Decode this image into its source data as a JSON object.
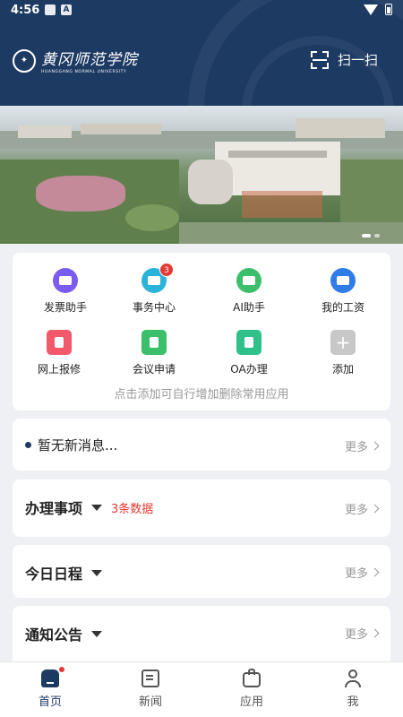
{
  "status_bar": {
    "time": "4:56",
    "icons": [
      "image-icon",
      "a-icon"
    ],
    "right_icons": [
      "wifi-icon",
      "battery-icon"
    ]
  },
  "header": {
    "logo_name": "黄冈师范学院",
    "logo_sub": "HUANGGANG NORMAL UNIVERSITY",
    "scan_label": "扫一扫"
  },
  "banner": {
    "page_count": 2,
    "active_page": 1
  },
  "apps": {
    "items": [
      {
        "label": "发票助手",
        "icon": "invoice-icon",
        "color": "#7b5cf0"
      },
      {
        "label": "事务中心",
        "icon": "affairs-icon",
        "color": "#2bb3d9",
        "badge": "3"
      },
      {
        "label": "AI助手",
        "icon": "ai-assistant-icon",
        "color": "#3cbf6a"
      },
      {
        "label": "我的工资",
        "icon": "salary-icon",
        "color": "#2f7de8"
      },
      {
        "label": "网上报修",
        "icon": "repair-icon",
        "color": "#f25a6b"
      },
      {
        "label": "会议申请",
        "icon": "meeting-icon",
        "color": "#3cbf6a"
      },
      {
        "label": "OA办理",
        "icon": "oa-icon",
        "color": "#2ec28a"
      },
      {
        "label": "添加",
        "icon": "add-icon",
        "color": "#c8c8c8"
      }
    ],
    "hint": "点击添加可自行增加删除常用应用"
  },
  "message": {
    "text": "暂无新消息...",
    "more": "更多"
  },
  "sections": [
    {
      "title": "办理事项",
      "count": "3条数据",
      "more": "更多"
    },
    {
      "title": "今日日程",
      "count": "",
      "more": "更多"
    },
    {
      "title": "通知公告",
      "count": "",
      "more": "更多"
    }
  ],
  "tabbar": [
    {
      "label": "首页",
      "icon": "home-icon",
      "active": true
    },
    {
      "label": "新闻",
      "icon": "news-icon"
    },
    {
      "label": "应用",
      "icon": "apps-icon"
    },
    {
      "label": "我",
      "icon": "profile-icon"
    }
  ],
  "colors": {
    "primary": "#1d3a63",
    "badge": "#e53935",
    "background": "#eef0f4"
  }
}
